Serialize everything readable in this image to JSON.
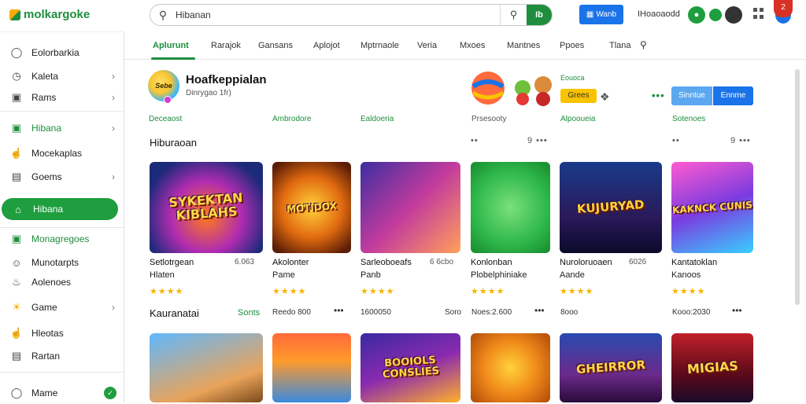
{
  "app": {
    "logo": "molkargoke"
  },
  "search": {
    "value": "Hibanan",
    "go_label": "Ib"
  },
  "top": {
    "btn_label": "Wanb",
    "label": "IHoaoaodd",
    "user_badge": "2"
  },
  "sidebar": {
    "items": [
      {
        "label": "Eolorbarkia"
      },
      {
        "label": "Kaleta"
      },
      {
        "label": "Rams"
      },
      {
        "label": "Hibana"
      },
      {
        "label": "Mocekaplas"
      },
      {
        "label": "Goems"
      },
      {
        "label": "Hibana"
      },
      {
        "label": "Monagregoes"
      },
      {
        "label": "Munotarpts"
      },
      {
        "label": "Aolenoes"
      },
      {
        "label": "Game"
      },
      {
        "label": "Hleotas"
      },
      {
        "label": "Rartan"
      },
      {
        "label": "Mame"
      }
    ]
  },
  "tabs": [
    "Aplurunt",
    "Rarajok",
    "Gansans",
    "Aplojot",
    "Mptrnaole",
    "Veria",
    "Mxoes",
    "Mantnes",
    "Ppoes",
    "Tlana"
  ],
  "hero": {
    "title": "Hoafkeppialan",
    "subtitle": "Dinrygao 1fr)",
    "icon_text": "Sebe",
    "yellow_label": "Eouoca",
    "yellow_btn": "Grees",
    "btn1": "Sinntue",
    "btn2": "Ennme",
    "meta": [
      "Deceaost",
      "Ambrodore",
      "Ealdoeria",
      "Prsesooty",
      "Alpooueia",
      "Sotenoes"
    ]
  },
  "section1": {
    "title": "Hiburaoan",
    "mid_right": "9 •••",
    "right": "9 •••",
    "cards": [
      {
        "art": "SYKEKTAN KIBLAHS",
        "title": "Setlotrgean",
        "num": "6.063",
        "sub": "Hlaten",
        "stars": "★★★★"
      },
      {
        "art": "MOTIDOX",
        "title": "Akolonter",
        "num": "",
        "sub": "Pame",
        "stars": "★★★★"
      },
      {
        "art": "",
        "title": "Sarleoboeafs",
        "num": "6 6cbo",
        "sub": "Panb",
        "stars": "★★★★"
      },
      {
        "art": "",
        "title": "Konlonban",
        "num": "",
        "sub": "Plobelphiniake",
        "stars": "★★★★"
      },
      {
        "art": "KUJURYAD",
        "title": "Nuroloruoaen",
        "num": "6026",
        "sub": "Aande",
        "stars": "★★★★"
      },
      {
        "art": "KAKNCK CUNIS",
        "title": "Kantatoklan",
        "num": "",
        "sub": "Kanoos",
        "stars": "★★★★"
      }
    ]
  },
  "section2": {
    "title": "Kauranatai",
    "tag": "Sonts",
    "labels": [
      "Reedo 800",
      "1600050",
      "Soro",
      "Noes:2.600",
      "8ooo",
      "Kooo:2030"
    ],
    "cards": [
      {
        "art": ""
      },
      {
        "art": ""
      },
      {
        "art": "BOOIOLS CONSLIES"
      },
      {
        "art": ""
      },
      {
        "art": "GHEIRROR"
      },
      {
        "art": "MIGIAS"
      }
    ]
  }
}
